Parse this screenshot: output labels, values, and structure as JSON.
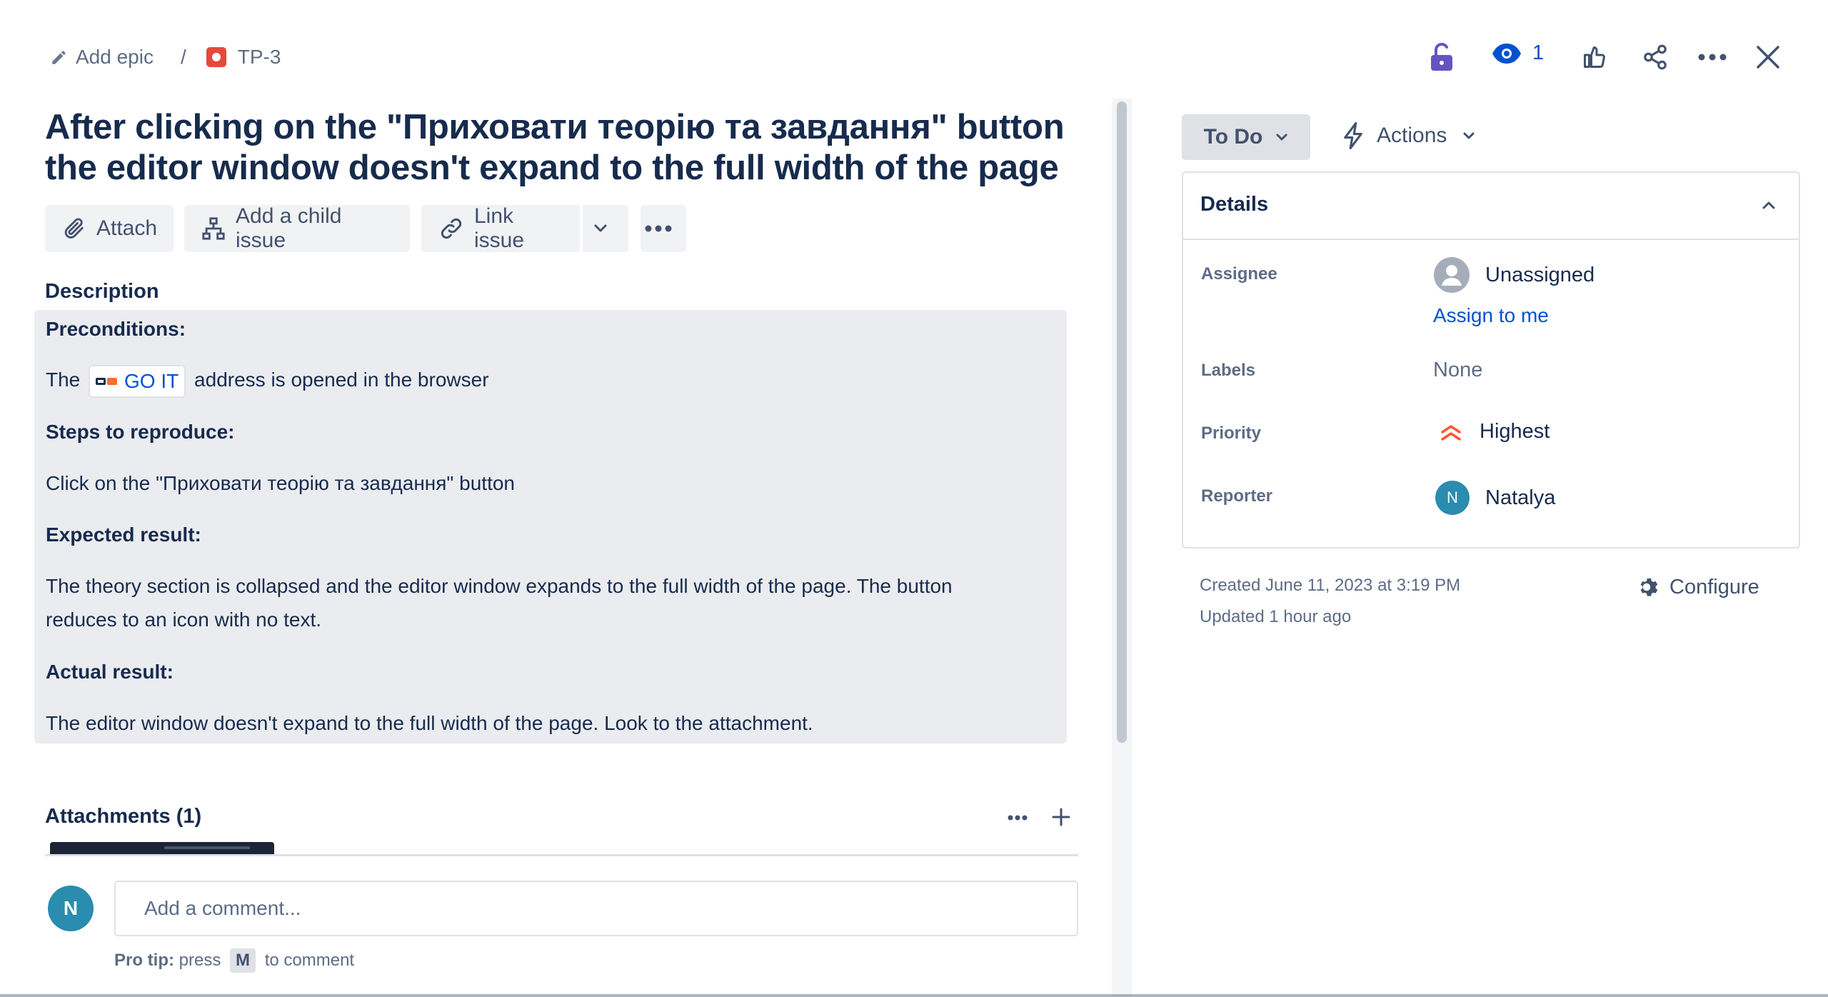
{
  "breadcrumb": {
    "add_epic": "Add epic",
    "separator": "/",
    "issue_key": "TP-3"
  },
  "header": {
    "watch_count": "1"
  },
  "issue": {
    "title": "After clicking on the \"Приховати теорію та завдання\" button the editor window doesn't expand to the full width of the page"
  },
  "toolbar": {
    "attach": "Attach",
    "add_child": "Add a child issue",
    "link_issue": "Link issue"
  },
  "description": {
    "heading": "Description",
    "preconditions_label": "Preconditions:",
    "pre_the": "The",
    "chip_text": "GO IT",
    "pre_rest": "address is opened in the browser",
    "steps_label": "Steps to reproduce:",
    "steps_text": "Click on the \"Приховати теорію та завдання\" button",
    "expected_label": "Expected result:",
    "expected_line1": "The theory section is collapsed and the editor window expands to the full width of the page. The button",
    "expected_line2": "reduces to an icon with no text.",
    "actual_label": "Actual result:",
    "actual_text": "The editor window doesn't expand to the full width of the page. Look to the attachment."
  },
  "attachments": {
    "heading": "Attachments (1)"
  },
  "comment": {
    "avatar_initial": "N",
    "placeholder": "Add a comment...",
    "tip_label": "Pro tip:",
    "tip_press": "press",
    "tip_key": "M",
    "tip_rest": "to comment"
  },
  "sidebar": {
    "status": "To Do",
    "actions": "Actions",
    "details_title": "Details",
    "assignee_label": "Assignee",
    "assignee_value": "Unassigned",
    "assign_to_me": "Assign to me",
    "labels_label": "Labels",
    "labels_value": "None",
    "priority_label": "Priority",
    "priority_value": "Highest",
    "reporter_label": "Reporter",
    "reporter_initial": "N",
    "reporter_value": "Natalya",
    "created": "Created June 11, 2023 at 3:19 PM",
    "updated": "Updated 1 hour ago",
    "configure": "Configure"
  },
  "colors": {
    "link": "#0052cc",
    "priority_highest": "#ff5630",
    "avatar_teal": "#2a8caf",
    "issue_type_bug": "#e5493a",
    "watch_purple": "#6554c0"
  }
}
